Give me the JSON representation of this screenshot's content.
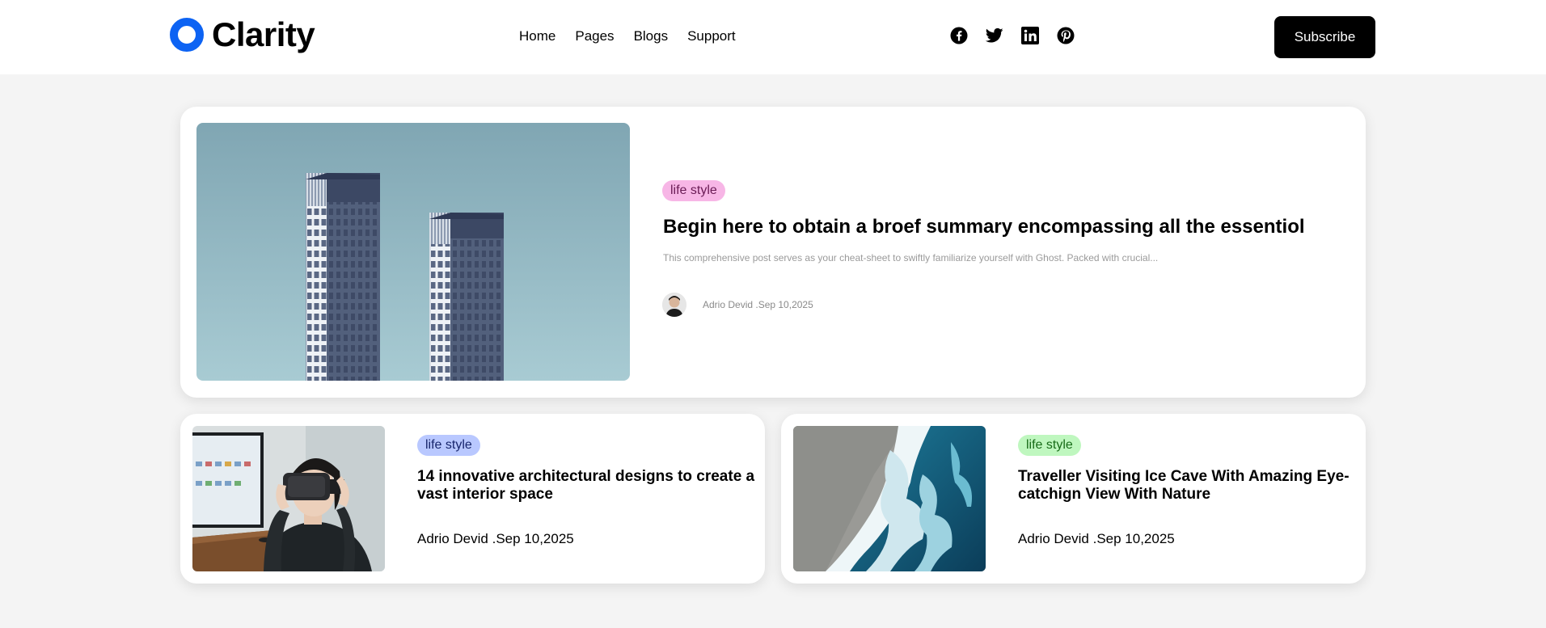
{
  "header": {
    "logo_text": "Clarity",
    "brand_color": "#0d63f3",
    "nav": [
      "Home",
      "Pages",
      "Blogs",
      "Support"
    ],
    "social_icons": [
      "facebook-icon",
      "twitter-icon",
      "linkedin-icon",
      "pinterest-icon"
    ],
    "subscribe_label": "Subscribe"
  },
  "featured": {
    "tag": "life style",
    "tag_color": "#f7b6e6",
    "title": "Begin here to obtain a broef summary encompassing all the essentiol",
    "excerpt": "This comprehensive post serves as your cheat-sheet to swiftly familiarize yourself with Ghost. Packed with crucial...",
    "meta": "Adrio Devid .Sep 10,2025"
  },
  "cards": [
    {
      "tag": "life style",
      "tag_color": "#b9c8ff",
      "title": "14 innovative architectural designs to create a vast interior space",
      "meta": "Adrio Devid .Sep 10,2025"
    },
    {
      "tag": "life style",
      "tag_color": "#bff7bf",
      "title": "Traveller Visiting Ice Cave With Amazing Eye-catchign View With Nature",
      "meta": "Adrio Devid .Sep 10,2025"
    }
  ]
}
